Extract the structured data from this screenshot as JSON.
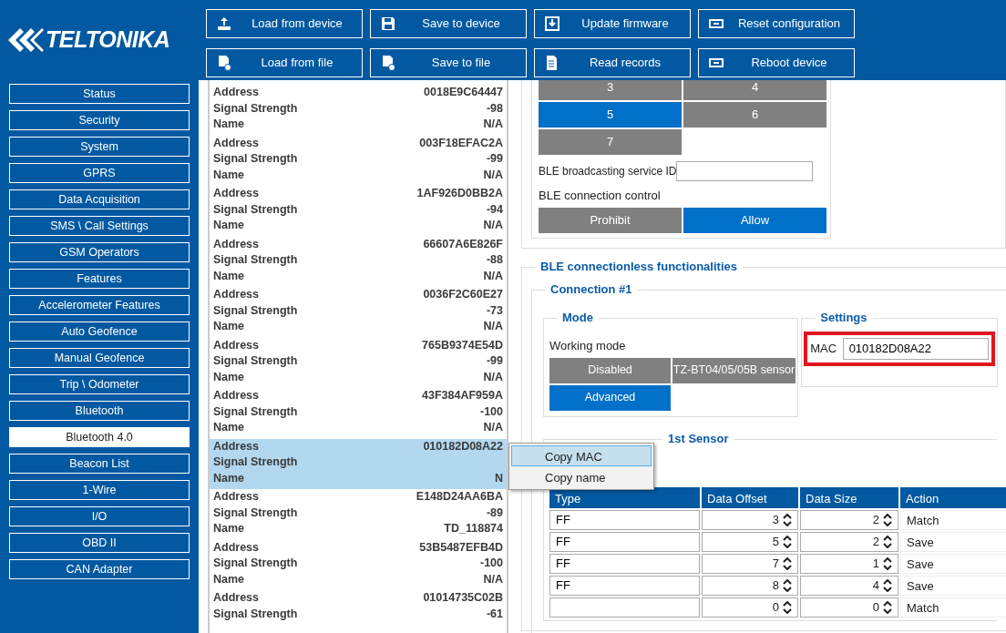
{
  "logo": "TELTONIKA",
  "toolbar": [
    {
      "label": "Load from device",
      "kind": "upload"
    },
    {
      "label": "Save to device",
      "kind": "floppy"
    },
    {
      "label": "Update firmware",
      "kind": "firmware"
    },
    {
      "label": "Reset configuration",
      "kind": "reset"
    },
    {
      "label": "Load from file",
      "kind": "file-plus"
    },
    {
      "label": "Save to file",
      "kind": "file-check"
    },
    {
      "label": "Read records",
      "kind": "file-list"
    },
    {
      "label": "Reboot device",
      "kind": "reset"
    }
  ],
  "sidebar": [
    {
      "label": "Status",
      "selected": false
    },
    {
      "label": "Security",
      "selected": false
    },
    {
      "label": "System",
      "selected": false
    },
    {
      "label": "GPRS",
      "selected": false
    },
    {
      "label": "Data Acquisition",
      "selected": false
    },
    {
      "label": "SMS \\ Call Settings",
      "selected": false
    },
    {
      "label": "GSM Operators",
      "selected": false
    },
    {
      "label": "Features",
      "selected": false
    },
    {
      "label": "Accelerometer Features",
      "selected": false
    },
    {
      "label": "Auto Geofence",
      "selected": false
    },
    {
      "label": "Manual Geofence",
      "selected": false
    },
    {
      "label": "Trip \\ Odometer",
      "selected": false
    },
    {
      "label": "Bluetooth",
      "selected": false
    },
    {
      "label": "Bluetooth 4.0",
      "selected": true
    },
    {
      "label": "Beacon List",
      "selected": false
    },
    {
      "label": "1-Wire",
      "selected": false
    },
    {
      "label": "I/O",
      "selected": false
    },
    {
      "label": "OBD II",
      "selected": false
    },
    {
      "label": "CAN Adapter",
      "selected": false
    }
  ],
  "devices": [
    {
      "selected": false,
      "fields": [
        [
          "Address",
          "0018E9C64447"
        ],
        [
          "Signal Strength",
          "-98"
        ],
        [
          "Name",
          "N/A"
        ]
      ]
    },
    {
      "selected": false,
      "fields": [
        [
          "Address",
          "003F18EFAC2A"
        ],
        [
          "Signal Strength",
          "-99"
        ],
        [
          "Name",
          "N/A"
        ]
      ]
    },
    {
      "selected": false,
      "fields": [
        [
          "Address",
          "1AF926D0BB2A"
        ],
        [
          "Signal Strength",
          "-94"
        ],
        [
          "Name",
          "N/A"
        ]
      ]
    },
    {
      "selected": false,
      "fields": [
        [
          "Address",
          "66607A6E826F"
        ],
        [
          "Signal Strength",
          "-88"
        ],
        [
          "Name",
          "N/A"
        ]
      ]
    },
    {
      "selected": false,
      "fields": [
        [
          "Address",
          "0036F2C60E27"
        ],
        [
          "Signal Strength",
          "-73"
        ],
        [
          "Name",
          "N/A"
        ]
      ]
    },
    {
      "selected": false,
      "fields": [
        [
          "Address",
          "765B9374E54D"
        ],
        [
          "Signal Strength",
          "-99"
        ],
        [
          "Name",
          "N/A"
        ]
      ]
    },
    {
      "selected": false,
      "fields": [
        [
          "Address",
          "43F384AF959A"
        ],
        [
          "Signal Strength",
          "-100"
        ],
        [
          "Name",
          "N/A"
        ]
      ]
    },
    {
      "selected": true,
      "fields": [
        [
          "Address",
          "010182D08A22"
        ],
        [
          "Signal Strength"
        ],
        [
          "Name",
          "N"
        ]
      ]
    },
    {
      "selected": false,
      "fields": [
        [
          "Address",
          "E148D24AA6BA"
        ],
        [
          "Signal Strength",
          "-89"
        ],
        [
          "Name",
          "TD_118874"
        ]
      ]
    },
    {
      "selected": false,
      "fields": [
        [
          "Address",
          "53B5487EFB4D"
        ],
        [
          "Signal Strength",
          "-100"
        ],
        [
          "Name",
          "N/A"
        ]
      ]
    },
    {
      "selected": false,
      "fields": [
        [
          "Address",
          "01014735C02B"
        ],
        [
          "Signal Strength",
          "-61"
        ]
      ]
    }
  ],
  "context_menu": [
    {
      "label": "Copy MAC",
      "selected": true
    },
    {
      "label": "Copy name",
      "selected": false
    }
  ],
  "number_buttons": [
    {
      "label": "3",
      "selected": false
    },
    {
      "label": "4",
      "selected": false
    },
    {
      "label": "5",
      "selected": true
    },
    {
      "label": "6",
      "selected": false
    },
    {
      "label": "7",
      "selected": false
    }
  ],
  "service_id": {
    "label": "BLE broadcasting service ID"
  },
  "connection_control": {
    "label": "BLE connection control",
    "options": [
      {
        "label": "Prohibit",
        "selected": false
      },
      {
        "label": "Allow",
        "selected": true
      }
    ]
  },
  "connectionless": {
    "title": "BLE connectionless functionalities",
    "connection": {
      "title": "Connection #1",
      "mode": {
        "title": "Mode",
        "label": "Working mode",
        "options": [
          {
            "label": "Disabled",
            "selected": false
          },
          {
            "label": "TZ-BT04/05/05B sensor",
            "selected": false
          },
          {
            "label": "Advanced",
            "selected": true
          }
        ]
      },
      "settings": {
        "title": "Settings",
        "highlighted": true,
        "mac_label": "MAC",
        "mac": "010182D08A22"
      },
      "sensor": {
        "title": "1st Sensor",
        "columns": [
          "Type",
          "Data Offset",
          "Data Size",
          "Action"
        ],
        "rows": [
          [
            "FF",
            "3",
            "2",
            "Match"
          ],
          [
            "FF",
            "5",
            "2",
            "Save"
          ],
          [
            "FF",
            "7",
            "1",
            "Save"
          ],
          [
            "FF",
            "8",
            "4",
            "Save"
          ],
          [
            "",
            "0",
            "0",
            "Match"
          ]
        ]
      }
    }
  }
}
